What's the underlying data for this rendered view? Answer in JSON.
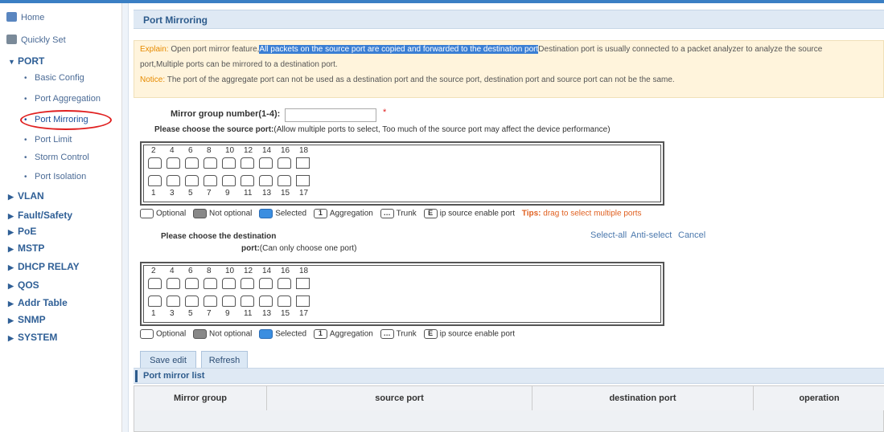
{
  "sidebar": {
    "home": "Home",
    "quickly_set": "Quickly Set",
    "port_section": "PORT",
    "port_items": [
      "Basic Config",
      "Port Aggregation",
      "Port Mirroring",
      "Port Limit",
      "Storm Control",
      "Port Isolation"
    ],
    "sections": [
      "VLAN",
      "Fault/Safety",
      "PoE",
      "MSTP",
      "DHCP RELAY",
      "QOS",
      "Addr Table",
      "SNMP",
      "SYSTEM"
    ]
  },
  "page": {
    "title": "Port Mirroring"
  },
  "explain": {
    "label": "Explain:",
    "text1": "Open port mirror feature,",
    "highlight": "All packets on the source port are copied and forwarded to the destination port",
    "text2": "Destination port is usually connected to a packet analyzer to analyze the source",
    "line2": "port,Multiple ports can be mirrored to a destination port.",
    "notice_label": "Notice:",
    "notice_text": "The port of the aggregate port can not be used as a destination port and the source port, destination port and source port can not be the same."
  },
  "form": {
    "group_label": "Mirror group number(1-4):",
    "group_value": "",
    "required_mark": "*",
    "source_label": "Please choose the source port:",
    "source_hint": "(Allow multiple ports to select, Too much of the source port may affect the device performance)",
    "dest_label": "Please choose the destination",
    "dest_label2": "port:",
    "dest_hint": "(Can only choose one port)",
    "select_all": "Select-all",
    "anti_select": "Anti-select",
    "cancel": "Cancel",
    "save": "Save edit",
    "refresh": "Refresh"
  },
  "ports": {
    "top": [
      "2",
      "4",
      "6",
      "8",
      "10",
      "12",
      "14",
      "16",
      "18"
    ],
    "bottom": [
      "1",
      "3",
      "5",
      "7",
      "9",
      "11",
      "13",
      "15",
      "17"
    ]
  },
  "legend": {
    "optional": "Optional",
    "not_optional": "Not optional",
    "selected": "Selected",
    "aggregation": "Aggregation",
    "trunk": "Trunk",
    "ip_source": "ip source enable port",
    "tips_label": "Tips:",
    "tips_text": "drag to select multiple ports"
  },
  "list": {
    "title": "Port mirror list",
    "columns": [
      "Mirror group",
      "source port",
      "destination port",
      "operation"
    ]
  },
  "colors": {
    "accent": "#3a7fc4",
    "highlight_circle": "#e02020",
    "notice": "#e68a00"
  }
}
